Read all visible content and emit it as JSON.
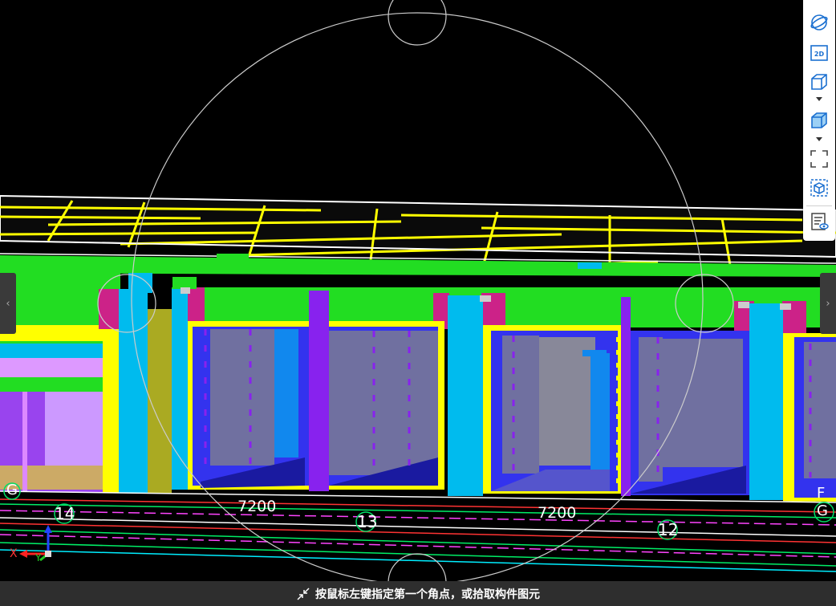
{
  "viewport": {
    "grid_labels": {
      "axis_14": "14",
      "axis_13": "13",
      "axis_12": "12",
      "axis_g_left": "G",
      "axis_g_right": "G",
      "axis_f_right": "F"
    },
    "dimensions": {
      "span_left": "7200",
      "span_right": "7200"
    },
    "axes_gizmo": {
      "x_label": "X",
      "y_label": "Y"
    },
    "colors": {
      "background": "#000000",
      "slab_yellow": "#ffff00",
      "wall_green": "#22dd22",
      "column_cyan": "#00bbee",
      "column_purple": "#8822ee",
      "beam_magenta": "#cc2288",
      "room_lavender": "#7070a0",
      "orbit_circle": "#cccccc"
    }
  },
  "toolbar": {
    "icons": [
      "orbit-icon",
      "view-2d-icon",
      "wireframe-cube-icon",
      "solid-cube-icon",
      "fullscreen-icon",
      "component-select-icon",
      "property-view-icon"
    ],
    "view_2d_label": "2D"
  },
  "statusbar": {
    "prompt": "按鼠标左键指定第一个角点，或拾取构件图元"
  }
}
